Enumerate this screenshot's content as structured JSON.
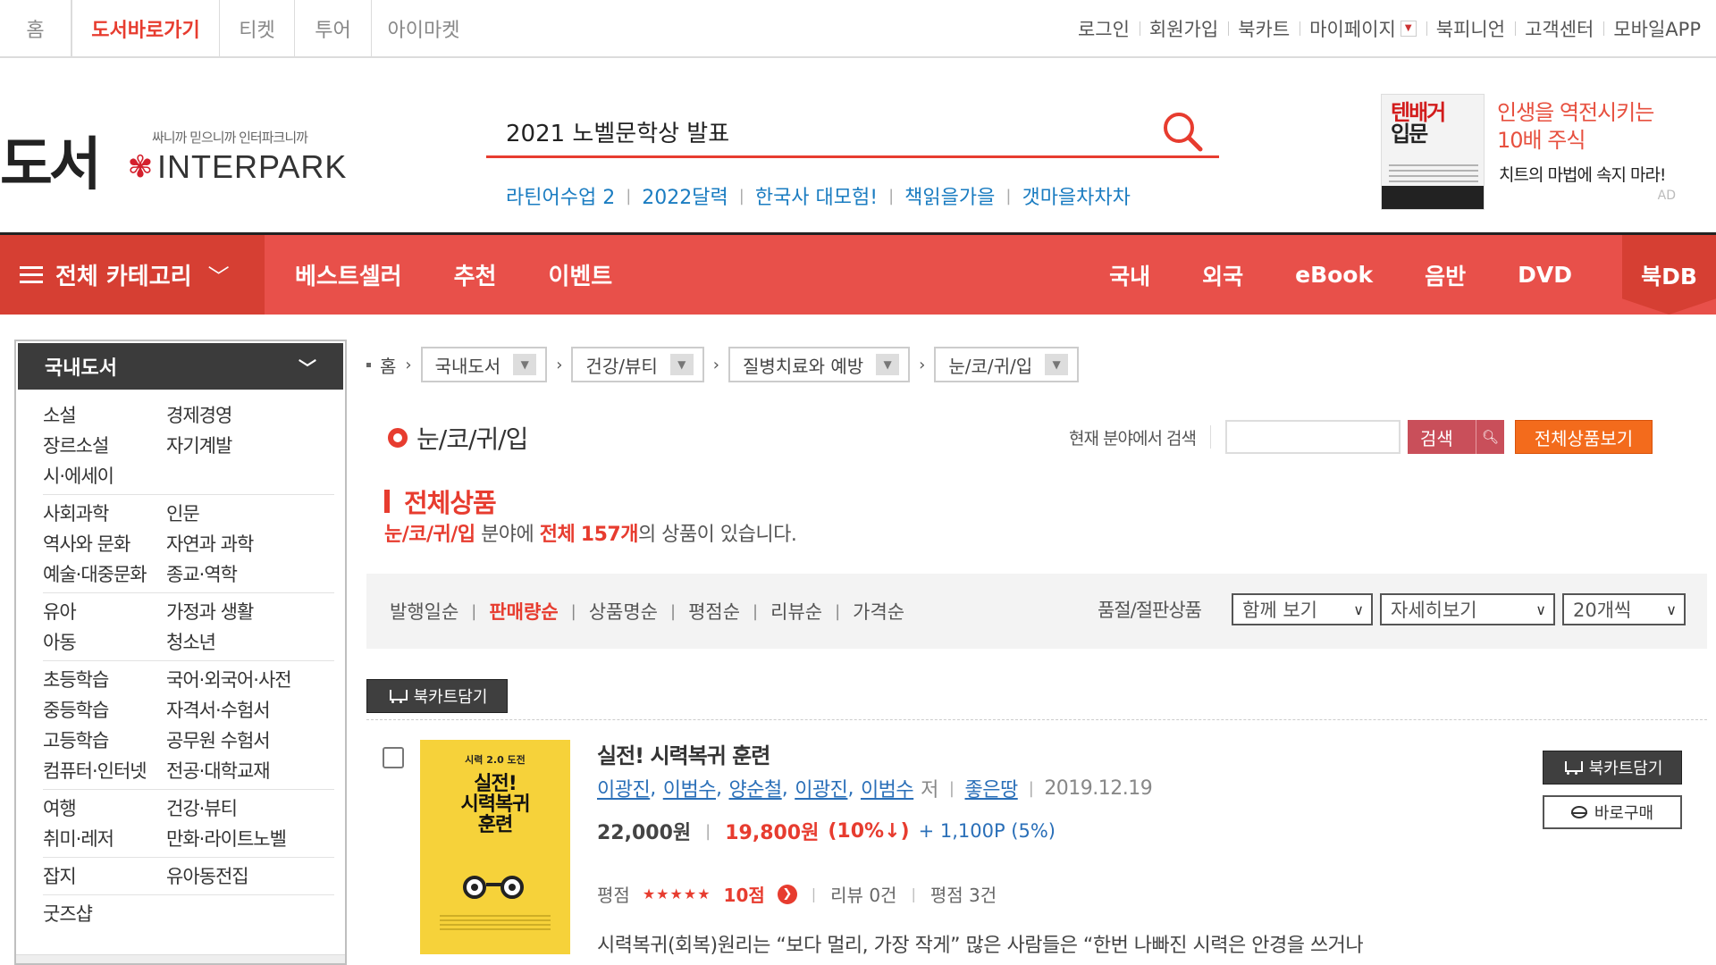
{
  "topnav": {
    "home": "홈",
    "book": "도서바로가기",
    "ticket": "티켓",
    "tour": "투어",
    "imarket": "아이마켓"
  },
  "utilnav": [
    "로그인",
    "회원가입",
    "북카트",
    "마이페이지",
    "북피니언",
    "고객센터",
    "모바일APP"
  ],
  "logo": {
    "word": "도서",
    "tagline": "싸니까 믿으니까 인터파크니까",
    "brand": "INTERPARK"
  },
  "search": {
    "value": "2021 노벨문학상 발표",
    "placeholder": ""
  },
  "hot_keywords": [
    "라틴어수업 2",
    "2022달력",
    "한국사 대모험!",
    "책읽을가을",
    "갯마을차차차"
  ],
  "ad": {
    "cover_line1": "텐배거",
    "cover_line2": "입문",
    "title_line1": "인생을 역전시키는",
    "title_line2": "10배 주식",
    "subtitle": "치트의 마법에 속지 마라!",
    "badge": "AD"
  },
  "catbar": {
    "all_label": "전체 카테고리",
    "menu": [
      "베스트셀러",
      "추천",
      "이벤트"
    ],
    "right": [
      "국내",
      "외국",
      "eBook",
      "음반",
      "DVD",
      "북DB"
    ]
  },
  "sidebar": {
    "title": "국내도서",
    "groups": [
      [
        [
          "소설",
          "경제경영"
        ],
        [
          "장르소설",
          "자기계발"
        ],
        [
          "시·에세이",
          ""
        ]
      ],
      [
        [
          "사회과학",
          "인문"
        ],
        [
          "역사와 문화",
          "자연과 과학"
        ],
        [
          "예술·대중문화",
          "종교·역학"
        ]
      ],
      [
        [
          "유아",
          "가정과 생활"
        ],
        [
          "아동",
          "청소년"
        ]
      ],
      [
        [
          "초등학습",
          "국어·외국어·사전"
        ],
        [
          "중등학습",
          "자격서·수험서"
        ],
        [
          "고등학습",
          "공무원 수험서"
        ],
        [
          "컴퓨터·인터넷",
          "전공·대학교재"
        ]
      ],
      [
        [
          "여행",
          "건강·뷰티"
        ],
        [
          "취미·레저",
          "만화·라이트노벨"
        ]
      ],
      [
        [
          "잡지",
          "유아동전집"
        ]
      ],
      [
        [
          "굿즈샵",
          ""
        ]
      ]
    ]
  },
  "breadcrumb": {
    "home": "홈",
    "levels": [
      "국내도서",
      "건강/뷰티",
      "질병치료와 예방",
      "눈/코/귀/입"
    ]
  },
  "section": {
    "title": "눈/코/귀/입",
    "search_label": "현재 분야에서 검색",
    "search_btn": "검색",
    "all_btn": "전체상품보기"
  },
  "total": {
    "heading": "전체상품",
    "cat": "눈/코/귀/입",
    "mid": " 분야에 ",
    "all": "전체",
    "count": "157개",
    "tail": "의 상품이 있습니다."
  },
  "sort": {
    "items": [
      "발행일순",
      "판매량순",
      "상품명순",
      "평점순",
      "리뷰순",
      "가격순"
    ],
    "active_index": 1,
    "soldout_label": "품절/절판상품",
    "select_view": "함께 보기",
    "select_detail": "자세히보기",
    "select_count": "20개씩"
  },
  "cart_top_label": "북카트담기",
  "product": {
    "cover_sub": "시력 2.0 도전",
    "cover_title": "실전! 시력복귀 훈련",
    "title": "실전! 시력복귀 훈련",
    "authors": [
      "이광진",
      "이범수",
      "양순철",
      "이광진",
      "이범수"
    ],
    "by": "저",
    "publisher": "좋은땅",
    "date": "2019.12.19",
    "price_orig": "22,000원",
    "price_sale": "19,800원",
    "discount": "(10%↓)",
    "points": "+ 1,100P (5%)",
    "rate_label": "평점",
    "stars": "★★★★★",
    "score": "10점",
    "reviews": "리뷰 0건",
    "rate_count": "평점 3건",
    "desc": "시력복귀(회복)원리는 “보다 멀리, 가장 작게” 많은 사람들은 “한번 나빠진 시력은 안경을 쓰거나",
    "cart_btn": "북카트담기",
    "buy_btn": "바로구매"
  },
  "colors": {
    "accent": "#e73c2f",
    "catbar": "#e8504a",
    "link": "#2a6fb8",
    "orange": "#f36b1c"
  }
}
